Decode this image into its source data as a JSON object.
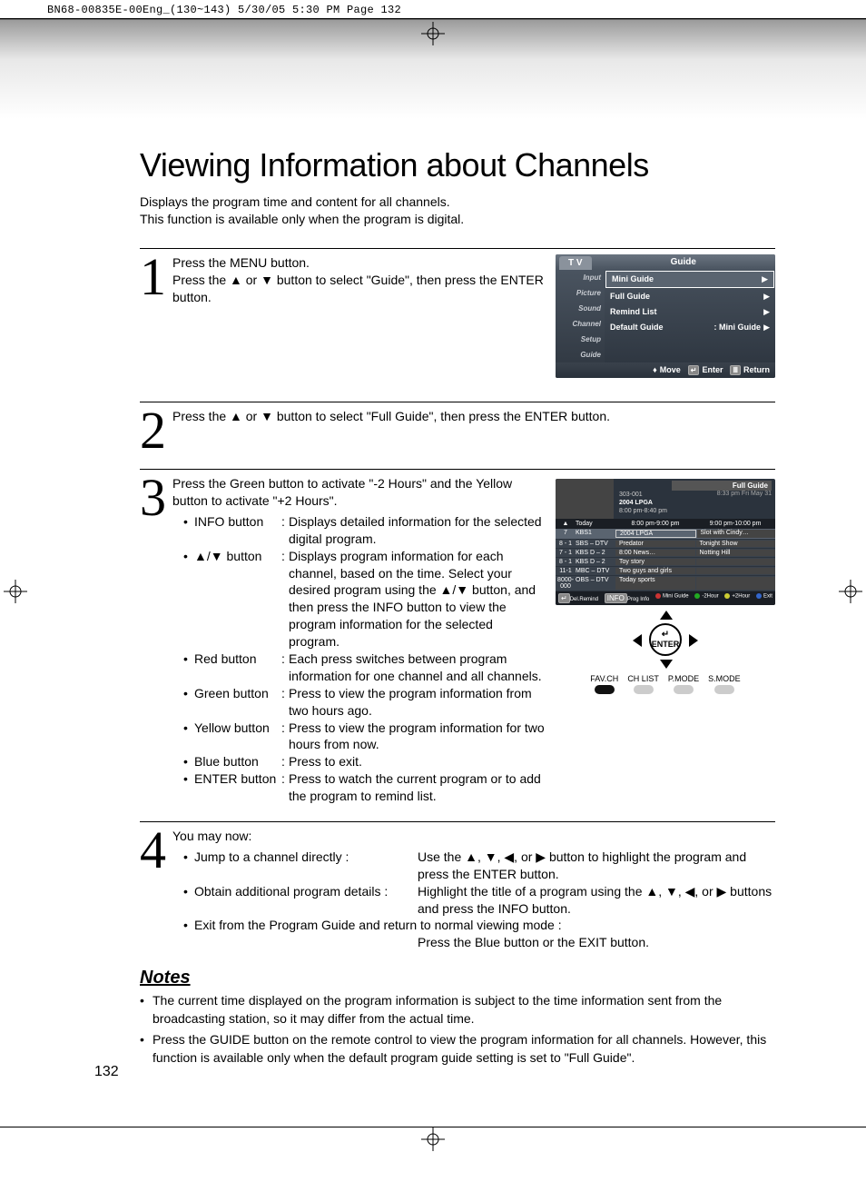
{
  "header": {
    "print_tag": "BN68-00835E-00Eng_(130~143)  5/30/05  5:30 PM  Page 132"
  },
  "title": "Viewing Information about Channels",
  "intro_line1": "Displays the program time and content for all channels.",
  "intro_line2": "This function is available only when the program is digital.",
  "steps": {
    "s1": {
      "num": "1",
      "l1": "Press the MENU button.",
      "l2": "Press the ▲ or ▼ button to select \"Guide\", then press the ENTER button."
    },
    "s2": {
      "num": "2",
      "l1": "Press the ▲ or ▼ button to select \"Full Guide\", then press the ENTER button."
    },
    "s3": {
      "num": "3",
      "l1": "Press the Green button to activate \"-2 Hours\" and the Yellow button to activate \"+2 Hours\".",
      "bullets": [
        {
          "label": "INFO button",
          "desc": "Displays detailed information for the selected digital program."
        },
        {
          "label": "▲/▼ button",
          "desc": "Displays program information for each channel, based on the time. Select your desired program using the ▲/▼ button, and then press the INFO button to view the program information for the selected program."
        },
        {
          "label": "Red button",
          "desc": "Each press switches between program information for one channel and all channels."
        },
        {
          "label": "Green button",
          "desc": "Press to view the program information from two hours ago."
        },
        {
          "label": "Yellow button",
          "desc": "Press to view the program information for two hours from now."
        },
        {
          "label": "Blue button",
          "desc": "Press to exit."
        },
        {
          "label": "ENTER button",
          "desc": "Press to watch the current program or to add the program to remind list."
        }
      ]
    },
    "s4": {
      "num": "4",
      "l1": "You may now:",
      "bullets": [
        {
          "label": "Jump to a channel directly :",
          "desc": "Use the ▲, ▼, ◀, or ▶ button to highlight the program and press the ENTER button."
        },
        {
          "label": "Obtain additional program details :",
          "desc": "Highlight the title of a program using the ▲, ▼, ◀, or ▶ buttons and press the INFO button."
        },
        {
          "label": "Exit from the Program Guide and return to normal viewing mode :",
          "desc": "Press the Blue button or the EXIT button."
        }
      ]
    }
  },
  "notes": {
    "heading": "Notes",
    "items": [
      "The current time displayed on the program information is subject to the time information sent from the broadcasting station, so it may differ from the actual time.",
      "Press the GUIDE button on the remote control to view the program information for all channels. However, this function is available only when the default program guide setting is set to \"Full Guide\"."
    ]
  },
  "page_number": "132",
  "tv_menu": {
    "tab_main": "T V",
    "tab_title": "Guide",
    "side": [
      "Input",
      "Picture",
      "Sound",
      "Channel",
      "Setup",
      "Guide"
    ],
    "rows": [
      {
        "label": "Mini Guide",
        "val": ""
      },
      {
        "label": "Full Guide",
        "val": ""
      },
      {
        "label": "Remind List",
        "val": ""
      },
      {
        "label": "Default Guide",
        "val": ": Mini Guide"
      }
    ],
    "foot": {
      "move": "Move",
      "enter": "Enter",
      "return": "Return"
    }
  },
  "full_guide": {
    "title": "Full Guide",
    "ch": "303-001",
    "prog": "2004 LPGA",
    "time": "8:00 pm-8:40 pm",
    "clock": "8:33 pm Fri May 31",
    "head": {
      "today": "Today",
      "c1": "8:00 pm-9:00 pm",
      "c2": "9:00 pm-10:00 pm"
    },
    "rows": [
      {
        "n": "7",
        "c": "KBS1",
        "p1": "2004 LPGA",
        "p2": "Slot with Cindy…",
        "sel": true
      },
      {
        "n": "8 - 1",
        "c": "SBS – DTV",
        "p1": "Predator",
        "p2": "Tonight Show"
      },
      {
        "n": "7 - 1",
        "c": "KBS D – 2",
        "p1": "8:00 News…",
        "p2": "Notting Hill"
      },
      {
        "n": "8 - 1",
        "c": "KBS D – 2",
        "p1": "Toy story",
        "p2": ""
      },
      {
        "n": "11-1",
        "c": "MBC – DTV",
        "p1": "Two guys and girls",
        "p2": ""
      },
      {
        "n": "8000-000",
        "c": "OBS – DTV",
        "p1": "Today sports",
        "p2": ""
      }
    ],
    "foot": {
      "a": "Del.Remind",
      "b": "Prog Info",
      "c": "Mini Guide",
      "d": "-2Hour",
      "e": "+2Hour",
      "f": "Exit"
    }
  },
  "remote": {
    "enter": "ENTER",
    "labels": [
      "FAV.CH",
      "CH LIST",
      "P.MODE",
      "S.MODE"
    ]
  }
}
